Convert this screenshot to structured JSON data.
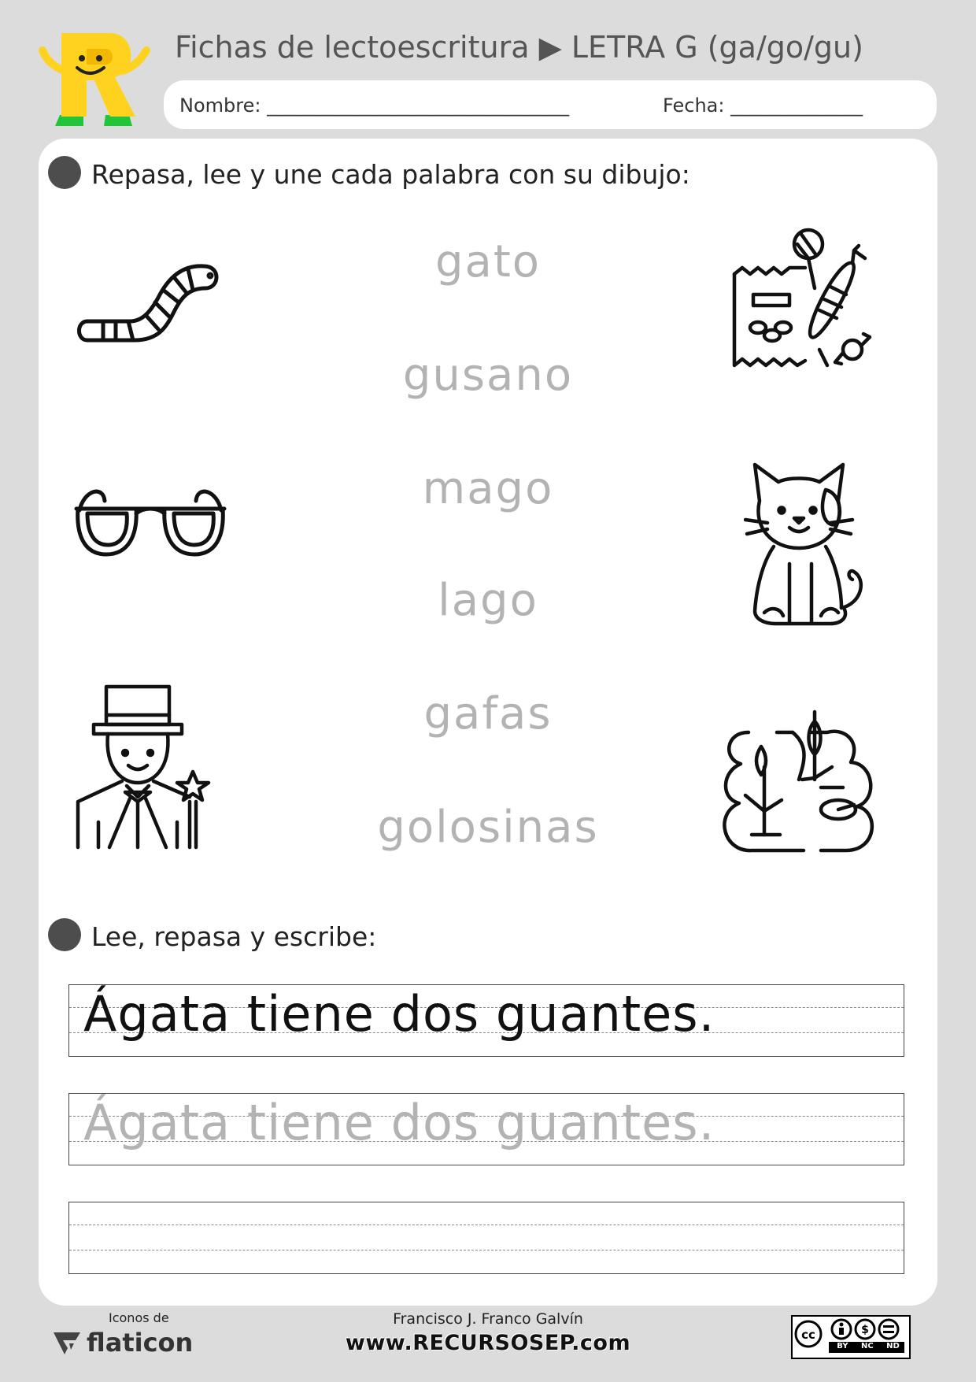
{
  "header": {
    "title": "Fichas de lectoescritura ▶ LETRA G (ga/go/gu)",
    "name_label": "Nombre: ________________________________",
    "date_label": "Fecha: ______________"
  },
  "section1": {
    "instruction": "Repasa, lee y une cada palabra con su dibujo:",
    "words": [
      "gato",
      "gusano",
      "mago",
      "lago",
      "gafas",
      "golosinas"
    ],
    "left_pictures": [
      "worm-icon",
      "glasses-icon",
      "magician-icon"
    ],
    "right_pictures": [
      "sweets-icon",
      "cat-icon",
      "pond-icon"
    ]
  },
  "section2": {
    "instruction": "Lee, repasa y escribe:",
    "model_sentence": "Ágata tiene dos guantes.",
    "trace_sentence": "Ágata tiene dos guantes."
  },
  "footer": {
    "icons_label": "Iconos de",
    "flaticon": "flaticon",
    "author": "Francisco J. Franco Galvín",
    "website": "www.RECURSOSEP.com",
    "license": [
      "BY",
      "NC",
      "ND"
    ]
  },
  "colors": {
    "background": "#dcdcdc",
    "card": "#ffffff",
    "bullet": "#4d4d4d",
    "trace_text": "#b3b3b3",
    "logo_yellow": "#ffd21f",
    "logo_green": "#22c53a"
  }
}
